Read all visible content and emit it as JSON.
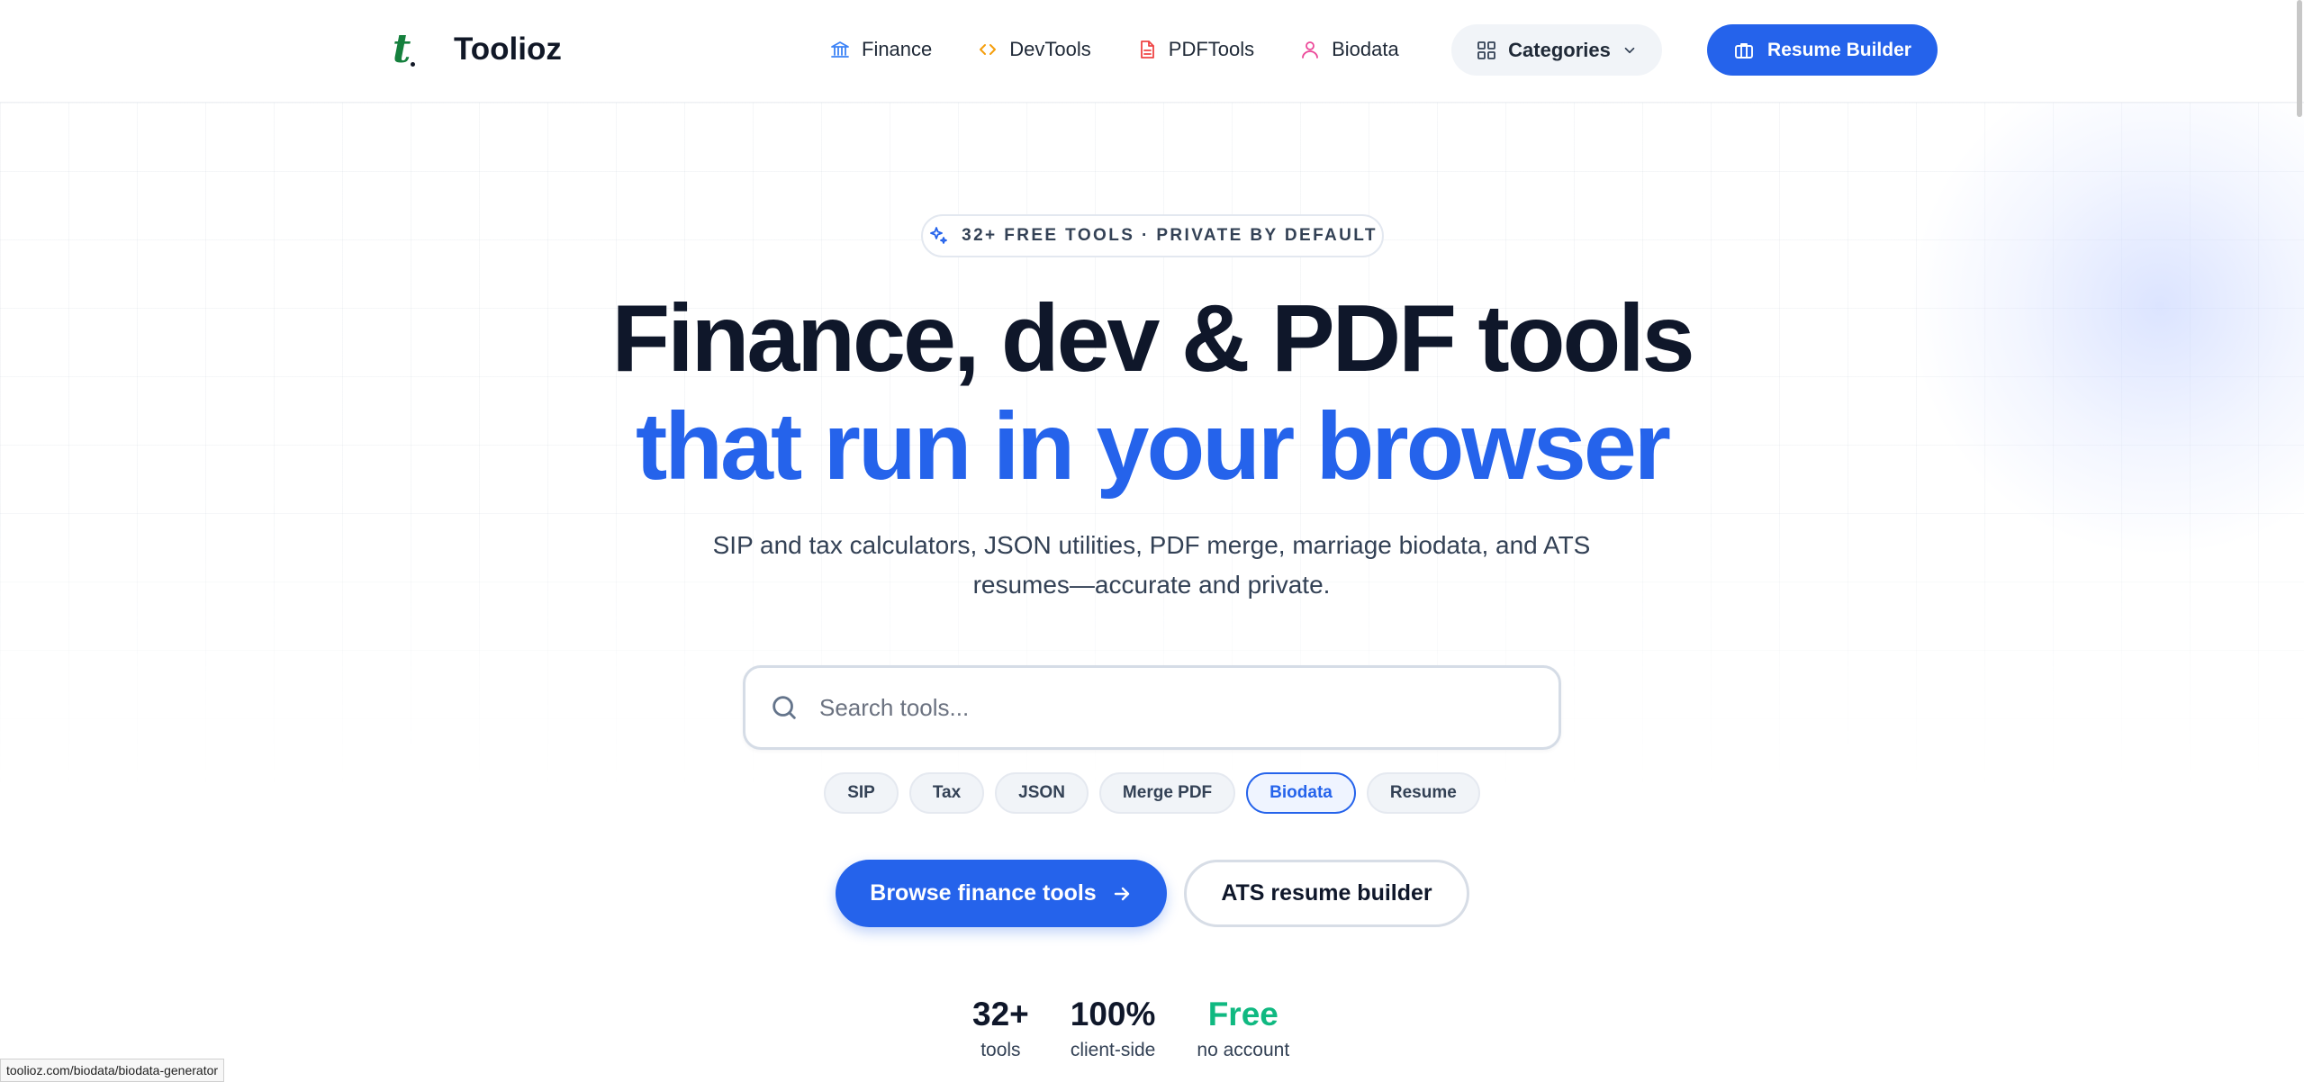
{
  "header": {
    "logo_mark": "t",
    "brand": "Toolioz",
    "nav": [
      {
        "label": "Finance",
        "icon": "bank-icon"
      },
      {
        "label": "DevTools",
        "icon": "code-icon"
      },
      {
        "label": "PDFTools",
        "icon": "document-icon"
      },
      {
        "label": "Biodata",
        "icon": "user-icon"
      }
    ],
    "categories_label": "Categories",
    "resume_label": "Resume Builder"
  },
  "hero": {
    "badge": "32+ FREE TOOLS · PRIVATE BY DEFAULT",
    "title_line1": "Finance, dev & PDF tools",
    "title_line2": "that run in your browser",
    "subtitle_line1": "SIP and tax calculators, JSON utilities, PDF merge, marriage biodata, and ATS",
    "subtitle_line2": "resumes—accurate and private.",
    "search_placeholder": "Search tools...",
    "chips": [
      "SIP",
      "Tax",
      "JSON",
      "Merge PDF",
      "Biodata",
      "Resume"
    ],
    "active_chip": "Biodata",
    "primary_cta": "Browse finance tools",
    "secondary_cta": "ATS resume builder"
  },
  "stats": [
    {
      "value": "32+",
      "label": "tools"
    },
    {
      "value": "100%",
      "label": "client-side"
    },
    {
      "value": "Free",
      "label": "no account"
    }
  ],
  "status_bar": {
    "url": "toolioz.com/biodata/biodata-generator"
  },
  "colors": {
    "accent": "#2563eb",
    "brand_green": "#15803d",
    "stat_green": "#10b981",
    "text": "#0f172a"
  }
}
